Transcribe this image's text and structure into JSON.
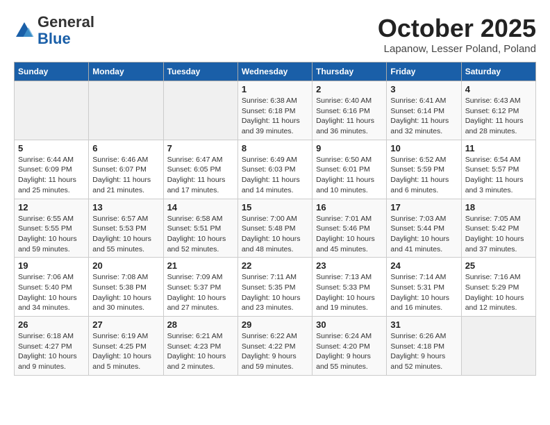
{
  "header": {
    "logo_line1": "General",
    "logo_line2": "Blue",
    "month": "October 2025",
    "location": "Lapanow, Lesser Poland, Poland"
  },
  "days_of_week": [
    "Sunday",
    "Monday",
    "Tuesday",
    "Wednesday",
    "Thursday",
    "Friday",
    "Saturday"
  ],
  "weeks": [
    [
      {
        "day": "",
        "info": ""
      },
      {
        "day": "",
        "info": ""
      },
      {
        "day": "",
        "info": ""
      },
      {
        "day": "1",
        "info": "Sunrise: 6:38 AM\nSunset: 6:18 PM\nDaylight: 11 hours\nand 39 minutes."
      },
      {
        "day": "2",
        "info": "Sunrise: 6:40 AM\nSunset: 6:16 PM\nDaylight: 11 hours\nand 36 minutes."
      },
      {
        "day": "3",
        "info": "Sunrise: 6:41 AM\nSunset: 6:14 PM\nDaylight: 11 hours\nand 32 minutes."
      },
      {
        "day": "4",
        "info": "Sunrise: 6:43 AM\nSunset: 6:12 PM\nDaylight: 11 hours\nand 28 minutes."
      }
    ],
    [
      {
        "day": "5",
        "info": "Sunrise: 6:44 AM\nSunset: 6:09 PM\nDaylight: 11 hours\nand 25 minutes."
      },
      {
        "day": "6",
        "info": "Sunrise: 6:46 AM\nSunset: 6:07 PM\nDaylight: 11 hours\nand 21 minutes."
      },
      {
        "day": "7",
        "info": "Sunrise: 6:47 AM\nSunset: 6:05 PM\nDaylight: 11 hours\nand 17 minutes."
      },
      {
        "day": "8",
        "info": "Sunrise: 6:49 AM\nSunset: 6:03 PM\nDaylight: 11 hours\nand 14 minutes."
      },
      {
        "day": "9",
        "info": "Sunrise: 6:50 AM\nSunset: 6:01 PM\nDaylight: 11 hours\nand 10 minutes."
      },
      {
        "day": "10",
        "info": "Sunrise: 6:52 AM\nSunset: 5:59 PM\nDaylight: 11 hours\nand 6 minutes."
      },
      {
        "day": "11",
        "info": "Sunrise: 6:54 AM\nSunset: 5:57 PM\nDaylight: 11 hours\nand 3 minutes."
      }
    ],
    [
      {
        "day": "12",
        "info": "Sunrise: 6:55 AM\nSunset: 5:55 PM\nDaylight: 10 hours\nand 59 minutes."
      },
      {
        "day": "13",
        "info": "Sunrise: 6:57 AM\nSunset: 5:53 PM\nDaylight: 10 hours\nand 55 minutes."
      },
      {
        "day": "14",
        "info": "Sunrise: 6:58 AM\nSunset: 5:51 PM\nDaylight: 10 hours\nand 52 minutes."
      },
      {
        "day": "15",
        "info": "Sunrise: 7:00 AM\nSunset: 5:48 PM\nDaylight: 10 hours\nand 48 minutes."
      },
      {
        "day": "16",
        "info": "Sunrise: 7:01 AM\nSunset: 5:46 PM\nDaylight: 10 hours\nand 45 minutes."
      },
      {
        "day": "17",
        "info": "Sunrise: 7:03 AM\nSunset: 5:44 PM\nDaylight: 10 hours\nand 41 minutes."
      },
      {
        "day": "18",
        "info": "Sunrise: 7:05 AM\nSunset: 5:42 PM\nDaylight: 10 hours\nand 37 minutes."
      }
    ],
    [
      {
        "day": "19",
        "info": "Sunrise: 7:06 AM\nSunset: 5:40 PM\nDaylight: 10 hours\nand 34 minutes."
      },
      {
        "day": "20",
        "info": "Sunrise: 7:08 AM\nSunset: 5:38 PM\nDaylight: 10 hours\nand 30 minutes."
      },
      {
        "day": "21",
        "info": "Sunrise: 7:09 AM\nSunset: 5:37 PM\nDaylight: 10 hours\nand 27 minutes."
      },
      {
        "day": "22",
        "info": "Sunrise: 7:11 AM\nSunset: 5:35 PM\nDaylight: 10 hours\nand 23 minutes."
      },
      {
        "day": "23",
        "info": "Sunrise: 7:13 AM\nSunset: 5:33 PM\nDaylight: 10 hours\nand 19 minutes."
      },
      {
        "day": "24",
        "info": "Sunrise: 7:14 AM\nSunset: 5:31 PM\nDaylight: 10 hours\nand 16 minutes."
      },
      {
        "day": "25",
        "info": "Sunrise: 7:16 AM\nSunset: 5:29 PM\nDaylight: 10 hours\nand 12 minutes."
      }
    ],
    [
      {
        "day": "26",
        "info": "Sunrise: 6:18 AM\nSunset: 4:27 PM\nDaylight: 10 hours\nand 9 minutes."
      },
      {
        "day": "27",
        "info": "Sunrise: 6:19 AM\nSunset: 4:25 PM\nDaylight: 10 hours\nand 5 minutes."
      },
      {
        "day": "28",
        "info": "Sunrise: 6:21 AM\nSunset: 4:23 PM\nDaylight: 10 hours\nand 2 minutes."
      },
      {
        "day": "29",
        "info": "Sunrise: 6:22 AM\nSunset: 4:22 PM\nDaylight: 9 hours\nand 59 minutes."
      },
      {
        "day": "30",
        "info": "Sunrise: 6:24 AM\nSunset: 4:20 PM\nDaylight: 9 hours\nand 55 minutes."
      },
      {
        "day": "31",
        "info": "Sunrise: 6:26 AM\nSunset: 4:18 PM\nDaylight: 9 hours\nand 52 minutes."
      },
      {
        "day": "",
        "info": ""
      }
    ]
  ]
}
